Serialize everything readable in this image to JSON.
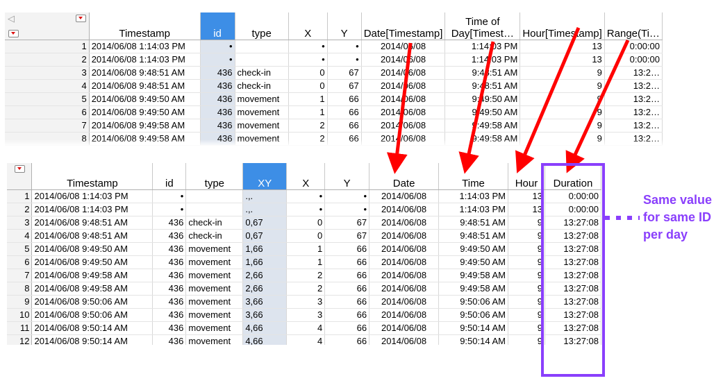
{
  "top_table": {
    "columns": [
      "Timestamp",
      "id",
      "type",
      "X",
      "Y",
      "Date[Timestamp]",
      "Time of Day[Timest…",
      "Hour[Timestamp]",
      "Range(Ti…"
    ],
    "selected_column": "id",
    "rows": [
      [
        "1",
        "2014/06/08 1:14:03 PM",
        "•",
        "",
        "•",
        "•",
        "2014/06/08",
        "1:14:03 PM",
        "13",
        "0:00:00"
      ],
      [
        "2",
        "2014/06/08 1:14:03 PM",
        "•",
        "",
        "•",
        "•",
        "2014/06/08",
        "1:14:03 PM",
        "13",
        "0:00:00"
      ],
      [
        "3",
        "2014/06/08 9:48:51 AM",
        "436",
        "check-in",
        "0",
        "67",
        "2014/06/08",
        "9:48:51 AM",
        "9",
        "13:2…"
      ],
      [
        "4",
        "2014/06/08 9:48:51 AM",
        "436",
        "check-in",
        "0",
        "67",
        "2014/06/08",
        "9:48:51 AM",
        "9",
        "13:2…"
      ],
      [
        "5",
        "2014/06/08 9:49:50 AM",
        "436",
        "movement",
        "1",
        "66",
        "2014/06/08",
        "9:49:50 AM",
        "9",
        "13:2…"
      ],
      [
        "6",
        "2014/06/08 9:49:50 AM",
        "436",
        "movement",
        "1",
        "66",
        "2014/06/08",
        "9:49:50 AM",
        "9",
        "13:2…"
      ],
      [
        "7",
        "2014/06/08 9:49:58 AM",
        "436",
        "movement",
        "2",
        "66",
        "2014/06/08",
        "9:49:58 AM",
        "9",
        "13:2…"
      ],
      [
        "8",
        "2014/06/08 9:49:58 AM",
        "436",
        "movement",
        "2",
        "66",
        "2014/06/08",
        "9:49:58 AM",
        "9",
        "13:2…"
      ]
    ]
  },
  "bottom_table": {
    "columns": [
      "Timestamp",
      "id",
      "type",
      "XY",
      "X",
      "Y",
      "Date",
      "Time",
      "Hour",
      "Duration"
    ],
    "selected_column": "XY",
    "rows": [
      [
        "1",
        "2014/06/08 1:14:03 PM",
        "•",
        "",
        ".,.",
        "•",
        "•",
        "2014/06/08",
        "1:14:03 PM",
        "13",
        "0:00:00"
      ],
      [
        "2",
        "2014/06/08 1:14:03 PM",
        "•",
        "",
        ".,.",
        "•",
        "•",
        "2014/06/08",
        "1:14:03 PM",
        "13",
        "0:00:00"
      ],
      [
        "3",
        "2014/06/08 9:48:51 AM",
        "436",
        "check-in",
        "0,67",
        "0",
        "67",
        "2014/06/08",
        "9:48:51 AM",
        "9",
        "13:27:08"
      ],
      [
        "4",
        "2014/06/08 9:48:51 AM",
        "436",
        "check-in",
        "0,67",
        "0",
        "67",
        "2014/06/08",
        "9:48:51 AM",
        "9",
        "13:27:08"
      ],
      [
        "5",
        "2014/06/08 9:49:50 AM",
        "436",
        "movement",
        "1,66",
        "1",
        "66",
        "2014/06/08",
        "9:49:50 AM",
        "9",
        "13:27:08"
      ],
      [
        "6",
        "2014/06/08 9:49:50 AM",
        "436",
        "movement",
        "1,66",
        "1",
        "66",
        "2014/06/08",
        "9:49:50 AM",
        "9",
        "13:27:08"
      ],
      [
        "7",
        "2014/06/08 9:49:58 AM",
        "436",
        "movement",
        "2,66",
        "2",
        "66",
        "2014/06/08",
        "9:49:58 AM",
        "9",
        "13:27:08"
      ],
      [
        "8",
        "2014/06/08 9:49:58 AM",
        "436",
        "movement",
        "2,66",
        "2",
        "66",
        "2014/06/08",
        "9:49:58 AM",
        "9",
        "13:27:08"
      ],
      [
        "9",
        "2014/06/08 9:50:06 AM",
        "436",
        "movement",
        "3,66",
        "3",
        "66",
        "2014/06/08",
        "9:50:06 AM",
        "9",
        "13:27:08"
      ],
      [
        "10",
        "2014/06/08 9:50:06 AM",
        "436",
        "movement",
        "3,66",
        "3",
        "66",
        "2014/06/08",
        "9:50:06 AM",
        "9",
        "13:27:08"
      ],
      [
        "11",
        "2014/06/08 9:50:14 AM",
        "436",
        "movement",
        "4,66",
        "4",
        "66",
        "2014/06/08",
        "9:50:14 AM",
        "9",
        "13:27:08"
      ],
      [
        "12",
        "2014/06/08 9:50:14 AM",
        "436",
        "movement",
        "4,66",
        "4",
        "66",
        "2014/06/08",
        "9:50:14 AM",
        "9",
        "13:27:08"
      ]
    ]
  },
  "annotation": {
    "note_text": "Same value for same ID per day",
    "arrow_color": "#ff0000",
    "highlight_color": "#8a3ffc"
  }
}
